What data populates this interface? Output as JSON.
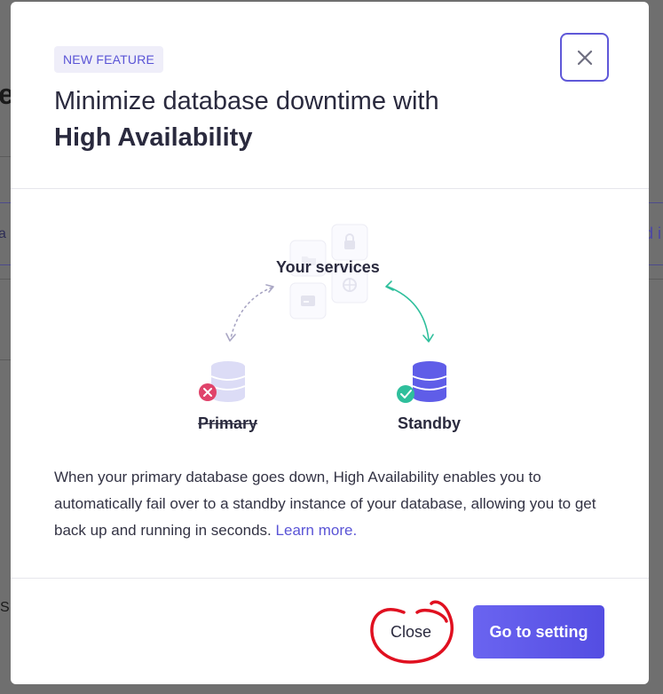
{
  "background": {
    "heading_fragment": "e",
    "left_fragment": "a",
    "right_fragment": "d i",
    "bottom_left_fragment": "S"
  },
  "modal": {
    "badge": "NEW FEATURE",
    "title_line1": "Minimize database downtime with",
    "title_line2": "High Availability",
    "close_icon": "close-icon",
    "illustration": {
      "services_label": "Your services",
      "primary_label": "Primary",
      "standby_label": "Standby",
      "primary_status": "failed",
      "standby_status": "ok"
    },
    "description": "When your primary database goes down, High Availability enables you to automatically fail over to a standby instance of your database, allowing you to get back up and running in seconds.",
    "learn_more": "Learn more.",
    "footer": {
      "close_label": "Close",
      "go_label": "Go to setting"
    }
  },
  "colors": {
    "accent": "#5a54d6",
    "success": "#2fbf9c",
    "error": "#e0436b",
    "annotation": "#e01020"
  }
}
